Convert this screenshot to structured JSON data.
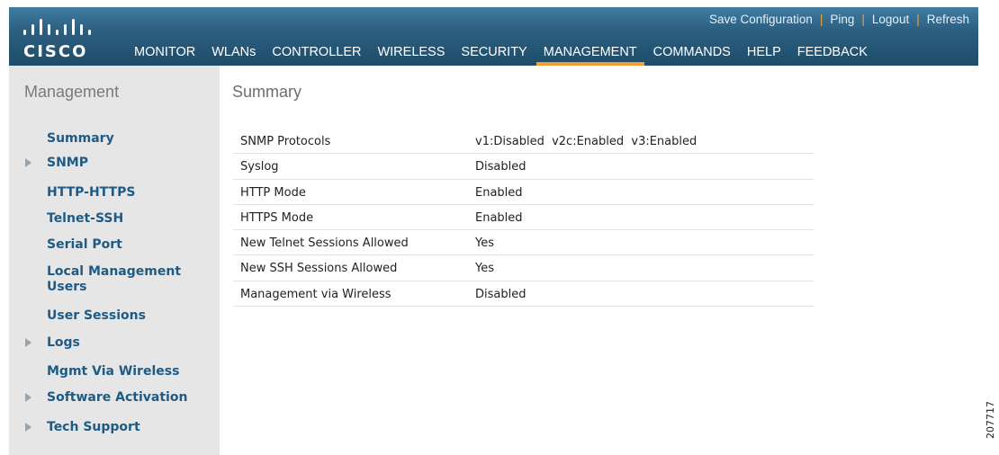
{
  "brand": {
    "logo_text": "CISCO"
  },
  "header": {
    "top_links": [
      "Save Configuration",
      "Ping",
      "Logout",
      "Refresh"
    ],
    "nav": [
      {
        "label": "MONITOR"
      },
      {
        "label": "WLANs"
      },
      {
        "label": "CONTROLLER"
      },
      {
        "label": "WIRELESS"
      },
      {
        "label": "SECURITY"
      },
      {
        "label": "MANAGEMENT",
        "active": true
      },
      {
        "label": "COMMANDS"
      },
      {
        "label": "HELP"
      },
      {
        "label": "FEEDBACK"
      }
    ]
  },
  "sidebar": {
    "title": "Management",
    "items": [
      {
        "label": "Summary",
        "expandable": false
      },
      {
        "label": "SNMP",
        "expandable": true
      },
      {
        "label": "HTTP-HTTPS",
        "expandable": false
      },
      {
        "label": "Telnet-SSH",
        "expandable": false
      },
      {
        "label": "Serial Port",
        "expandable": false
      },
      {
        "label": "Local Management Users",
        "expandable": false
      },
      {
        "label": "User Sessions",
        "expandable": false
      },
      {
        "label": "Logs",
        "expandable": true
      },
      {
        "label": "Mgmt Via Wireless",
        "expandable": false
      },
      {
        "label": "Software Activation",
        "expandable": true
      },
      {
        "label": "Tech Support",
        "expandable": true
      }
    ]
  },
  "main": {
    "title": "Summary",
    "rows": [
      {
        "key": "SNMP Protocols",
        "value": "v1:Disabled  v2c:Enabled  v3:Enabled"
      },
      {
        "key": "Syslog",
        "value": "Disabled"
      },
      {
        "key": "HTTP Mode",
        "value": "Enabled"
      },
      {
        "key": "HTTPS Mode",
        "value": "Enabled"
      },
      {
        "key": "New Telnet Sessions Allowed",
        "value": "Yes"
      },
      {
        "key": "New SSH Sessions Allowed",
        "value": "Yes"
      },
      {
        "key": "Management via Wireless",
        "value": "Disabled"
      }
    ]
  },
  "figure_id": "207717",
  "colors": {
    "header": "#2c5f80",
    "active_tab": "#f0a032",
    "link": "#1d5b86",
    "sidebar_bg": "#e6e6e6"
  }
}
